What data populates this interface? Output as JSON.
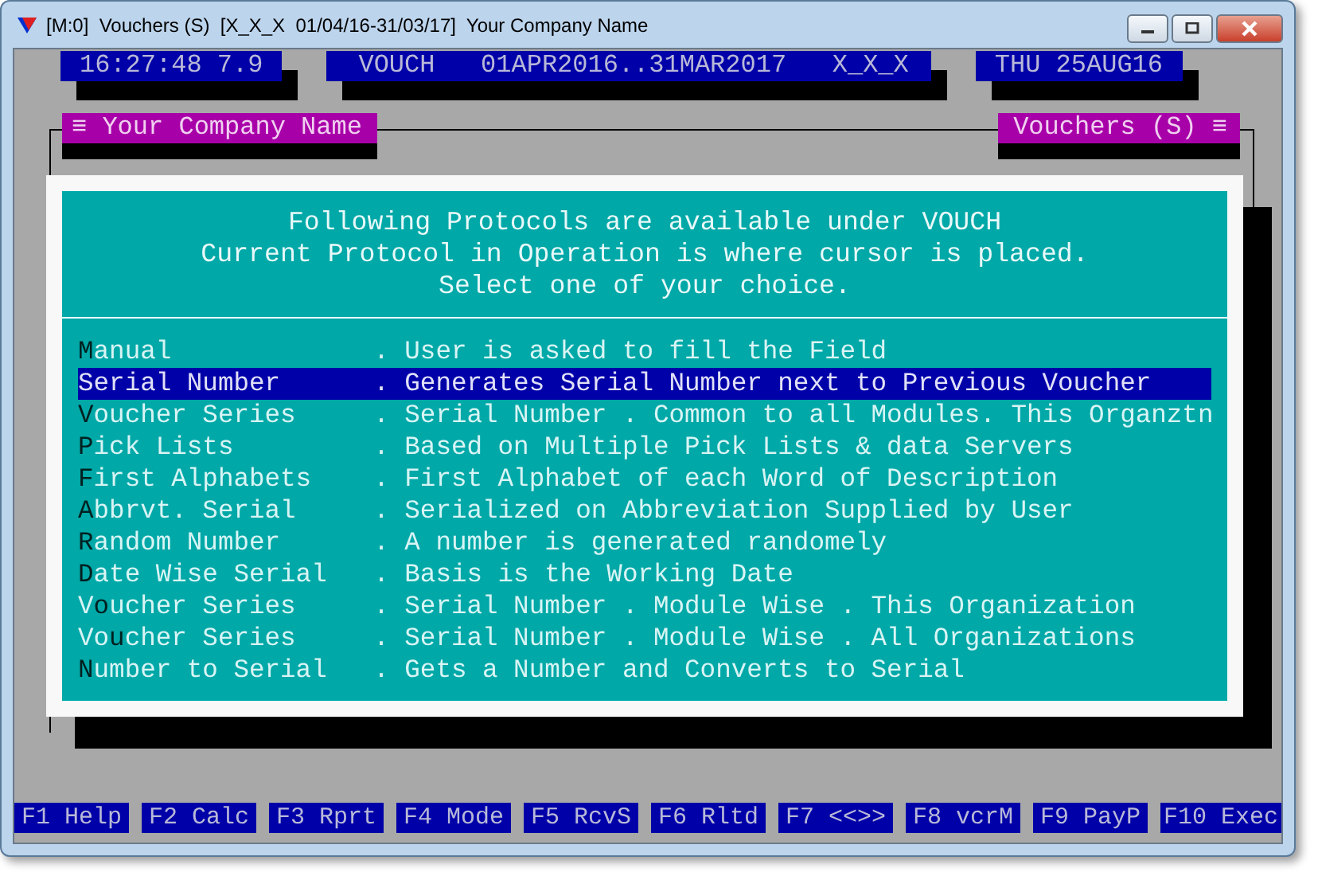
{
  "window": {
    "title": "[M:0]  Vouchers (S)  [X_X_X  01/04/16-31/03/17]  Your Company Name"
  },
  "status_boxes": [
    {
      "text": "16:27:48 7.9"
    },
    {
      "text": "VOUCH   01APR2016..31MAR2017   X_X_X"
    },
    {
      "text": "THU 25AUG16"
    }
  ],
  "panel_headers": {
    "left": "≡ Your Company Name",
    "right": "Vouchers (S) ≡"
  },
  "dialog": {
    "heading": [
      "Following Protocols are available under VOUCH",
      "Current Protocol in Operation is where cursor is placed.",
      "Select one of your choice."
    ],
    "options": [
      {
        "hotkey": "M",
        "label_rest": "anual",
        "description": ". User is asked to fill the Field",
        "selected": false
      },
      {
        "hotkey": "S",
        "label_rest": "erial Number",
        "description": ". Generates Serial Number next to Previous Voucher",
        "selected": true
      },
      {
        "hotkey": "V",
        "label_rest": "oucher Series",
        "description": ". Serial Number . Common to all Modules. This Organztn",
        "selected": false
      },
      {
        "hotkey": "P",
        "label_rest": "ick Lists",
        "description": ". Based on Multiple Pick Lists & data Servers",
        "selected": false
      },
      {
        "hotkey": "F",
        "label_rest": "irst Alphabets",
        "description": ". First Alphabet of each Word of Description",
        "selected": false
      },
      {
        "hotkey": "A",
        "label_rest": "bbrvt. Serial",
        "description": ". Serialized on Abbreviation Supplied by User",
        "selected": false
      },
      {
        "hotkey": "R",
        "label_rest": "andom Number",
        "description": ". A number is generated randomely",
        "selected": false
      },
      {
        "hotkey": "D",
        "label_rest": "ate Wise Serial",
        "description": ". Basis is the Working Date",
        "selected": false
      },
      {
        "label_before": "V",
        "hotkey": "o",
        "label_rest": "ucher Series",
        "description": ". Serial Number . Module Wise . This Organization",
        "selected": false
      },
      {
        "label_before": "Vo",
        "hotkey": "u",
        "label_rest": "cher Series",
        "description": ". Serial Number . Module Wise . All Organizations",
        "selected": false
      },
      {
        "hotkey": "N",
        "label_rest": "umber to Serial",
        "description": ". Gets a Number and Converts to Serial",
        "selected": false
      }
    ]
  },
  "function_keys": [
    "F1 Help",
    "F2 Calc",
    "F3 Rprt",
    "F4 Mode",
    "F5 RcvS",
    "F6 Rltd",
    "F7 <<>>",
    "F8 vcrM",
    "F9 PayP",
    "F10 Exec"
  ]
}
